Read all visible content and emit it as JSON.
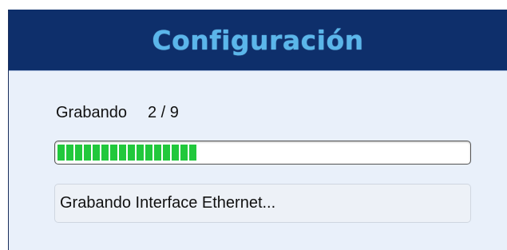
{
  "header": {
    "title": "Configuración"
  },
  "status": {
    "label": "Grabando",
    "step": "2 / 9"
  },
  "progress": {
    "fraction": 0.35,
    "color": "#21c83c"
  },
  "message": {
    "text": "Grabando Interface Ethernet..."
  },
  "colors": {
    "header_bg": "#0e2f6b",
    "title": "#5bb6ea",
    "body_bg": "#e9f0fa"
  }
}
